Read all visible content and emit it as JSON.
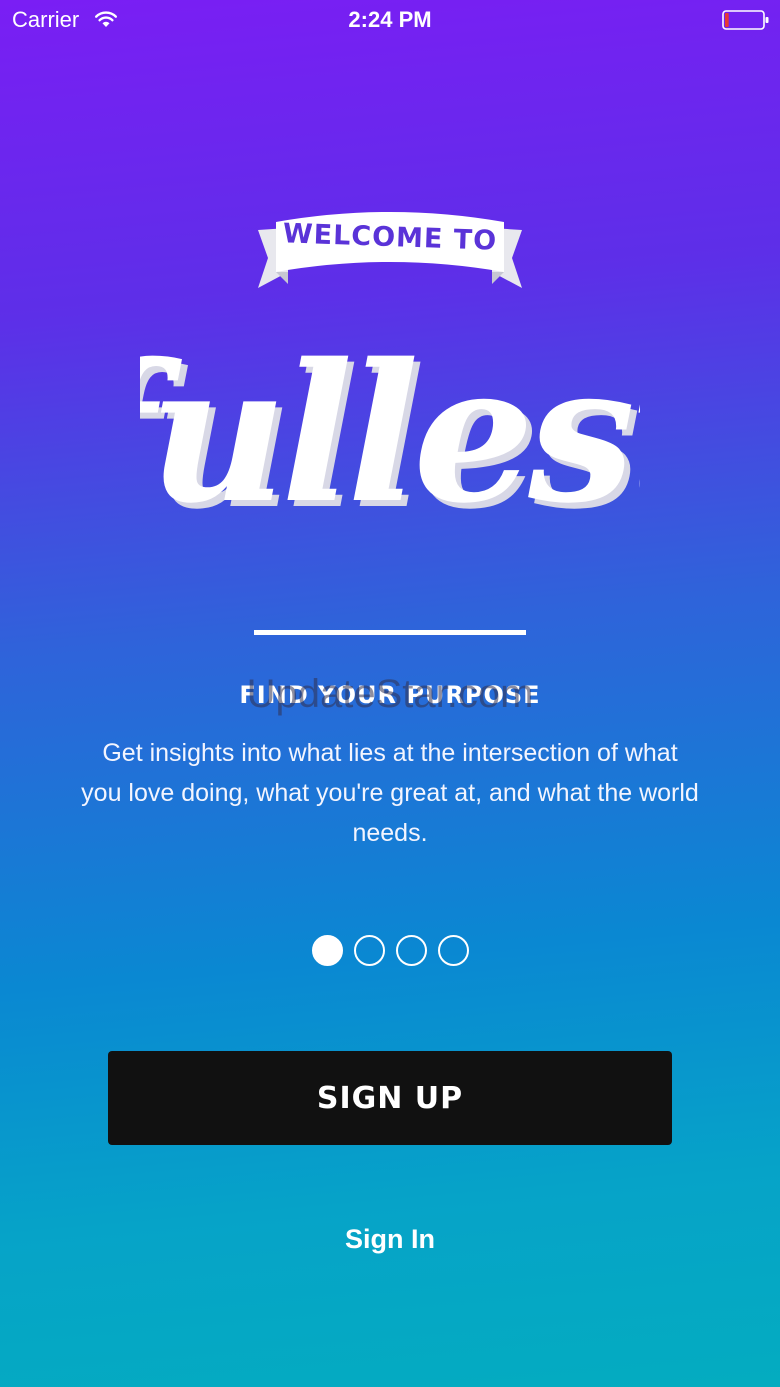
{
  "status_bar": {
    "carrier": "Carrier",
    "time": "2:24 PM",
    "battery_level": 0.1
  },
  "banner": {
    "text": "WELCOME TO"
  },
  "logo": {
    "text": "fullest"
  },
  "onboarding": {
    "headline": "FIND YOUR PURPOSE",
    "description": "Get insights into what lies at the intersection of what you love doing, what you're great at, and what the world needs.",
    "page_count": 4,
    "current_page": 1
  },
  "watermark": "UpdateStar.com",
  "actions": {
    "signup_label": "SIGN UP",
    "signin_label": "Sign In"
  },
  "colors": {
    "gradient_top": "#7a1ef4",
    "gradient_bottom": "#04acc0",
    "banner_text": "#5a33d8",
    "button_bg": "#111111",
    "battery_low": "#e53935"
  }
}
